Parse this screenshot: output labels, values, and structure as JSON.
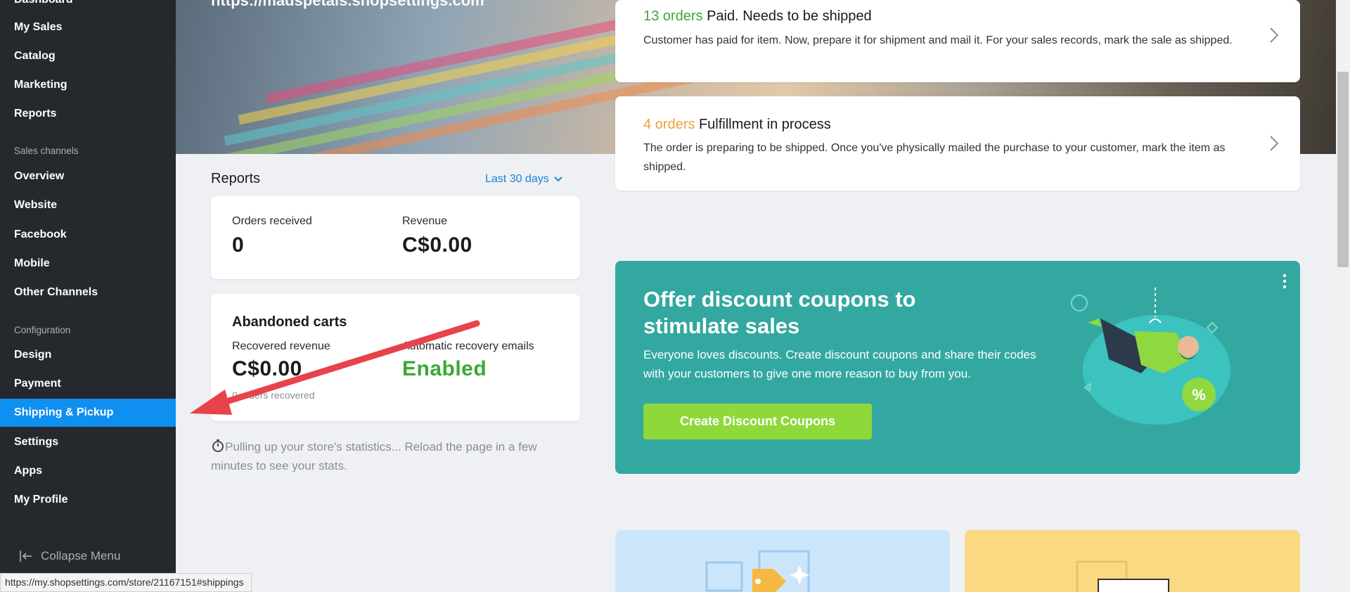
{
  "sidebar": {
    "items_top": [
      {
        "label": "Dashboard"
      },
      {
        "label": "My Sales"
      },
      {
        "label": "Catalog"
      },
      {
        "label": "Marketing"
      },
      {
        "label": "Reports"
      }
    ],
    "section_sales": "Sales channels",
    "items_sales": [
      {
        "label": "Overview"
      },
      {
        "label": "Website"
      },
      {
        "label": "Facebook"
      },
      {
        "label": "Mobile"
      },
      {
        "label": "Other Channels"
      }
    ],
    "section_config": "Configuration",
    "items_config": [
      {
        "label": "Design"
      },
      {
        "label": "Payment"
      },
      {
        "label": "Shipping & Pickup",
        "active": true
      },
      {
        "label": "Settings"
      },
      {
        "label": "Apps"
      },
      {
        "label": "My Profile"
      }
    ],
    "collapse_label": "Collapse Menu",
    "active_color": "#0f8ff0"
  },
  "hero": {
    "url": "https://madspetals.shopsettings.com"
  },
  "reports": {
    "title": "Reports",
    "period": "Last 30 days",
    "orders_received_label": "Orders received",
    "orders_received_value": "0",
    "revenue_label": "Revenue",
    "revenue_value": "C$0.00",
    "abandoned_title": "Abandoned carts",
    "recovered_revenue_label": "Recovered revenue",
    "recovered_revenue_value": "C$0.00",
    "recovery_emails_label": "Automatic recovery emails",
    "recovery_emails_value": "Enabled",
    "orders_recovered": "0 orders recovered",
    "stats_note": "Pulling up your store's statistics... Reload the page in a few minutes to see your stats."
  },
  "orders": [
    {
      "count": "13 orders",
      "status": "Paid. Needs to be shipped",
      "description": "Customer has paid for item. Now, prepare it for shipment and mail it. For your sales records, mark the sale as shipped.",
      "count_color": "#3aa935"
    },
    {
      "count": "4 orders",
      "status": "Fulfillment in process",
      "description": "The order is preparing to be shipped. Once you've physically mailed the purchase to your customer, mark the item as shipped.",
      "count_color": "#f0a03c"
    }
  ],
  "promo": {
    "title": "Offer discount coupons to stimulate sales",
    "text": "Everyone loves discounts. Create discount coupons and share their codes with your customers to give one more reason to buy from you.",
    "button": "Create Discount Coupons",
    "background": "#33a8a0",
    "button_color": "#8ed83a",
    "badge": "%"
  },
  "statusbar": {
    "url": "https://my.shopsettings.com/store/21167151#shippings"
  }
}
